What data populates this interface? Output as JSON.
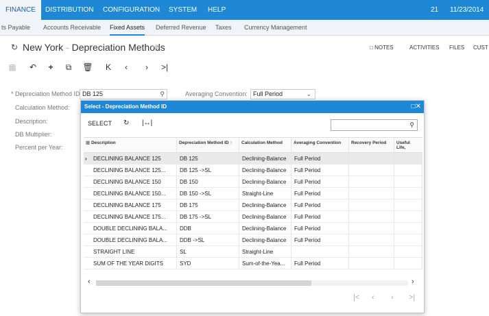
{
  "topnav": {
    "tabs": [
      "FINANCE",
      "DISTRIBUTION",
      "CONFIGURATION",
      "SYSTEM",
      "HELP"
    ],
    "counter": "21",
    "date": "11/23/2014"
  },
  "subnav": {
    "items": [
      "ts Payable",
      "Accounts Receivable",
      "Fixed Assets",
      "Deferred Revenue",
      "Taxes",
      "Currency Management"
    ]
  },
  "titlebar": {
    "company": "New York",
    "separator": "-",
    "page": "Depreciation Methods",
    "links": [
      "NOTES",
      "ACTIVITIES",
      "FILES",
      "CUST"
    ]
  },
  "form": {
    "method_id_label": "* Depreciation Method ID:",
    "method_id_value": "DB 125",
    "averaging_label": "Averaging Convention:",
    "averaging_value": "Full Period",
    "calc_label": "Calculation Method:",
    "desc_label": "Description:",
    "multiplier_label": "DB Multiplier:",
    "percent_label": "Percent per Year:"
  },
  "dialog": {
    "title": "Select - Depreciation Method ID",
    "select_label": "SELECT",
    "search_value": "",
    "columns": [
      "Description",
      "Depreciation Method ID ↑",
      "Calculation Method",
      "Averaging Convention",
      "Recovery Period",
      "Useful Life,"
    ],
    "rows": [
      {
        "desc": "DECLINING BALANCE 125",
        "id": "DB 125",
        "calc": "Declining-Balance",
        "avg": "Full Period"
      },
      {
        "desc": "DECLINING BALANCE 125...",
        "id": "DB 125 ->SL",
        "calc": "Declining-Balance",
        "avg": "Full Period"
      },
      {
        "desc": "DECLINING BALANCE 150",
        "id": "DB 150",
        "calc": "Declining-Balance",
        "avg": "Full Period"
      },
      {
        "desc": "DECLINING BALANCE 150...",
        "id": "DB 150 ->SL",
        "calc": "Straight-Line",
        "avg": "Full Period"
      },
      {
        "desc": "DECLINING BALANCE 175",
        "id": "DB 175",
        "calc": "Declining-Balance",
        "avg": "Full Period"
      },
      {
        "desc": "DECLINING BALANCE 175...",
        "id": "DB 175 ->SL",
        "calc": "Declining-Balance",
        "avg": "Full Period"
      },
      {
        "desc": "DOUBLE DECLINING BALA...",
        "id": "DDB",
        "calc": "Declining-Balance",
        "avg": "Full Period"
      },
      {
        "desc": "DOUBLE DECLINING BALA...",
        "id": "DDB ->SL",
        "calc": "Declining-Balance",
        "avg": "Full Period"
      },
      {
        "desc": "STRAIGHT LINE",
        "id": "SL",
        "calc": "Straight-Line",
        "avg": ""
      },
      {
        "desc": "SUM OF THE YEAR DIGITS",
        "id": "SYD",
        "calc": "Sum-of-the-Yea...",
        "avg": "Full Period"
      }
    ]
  }
}
